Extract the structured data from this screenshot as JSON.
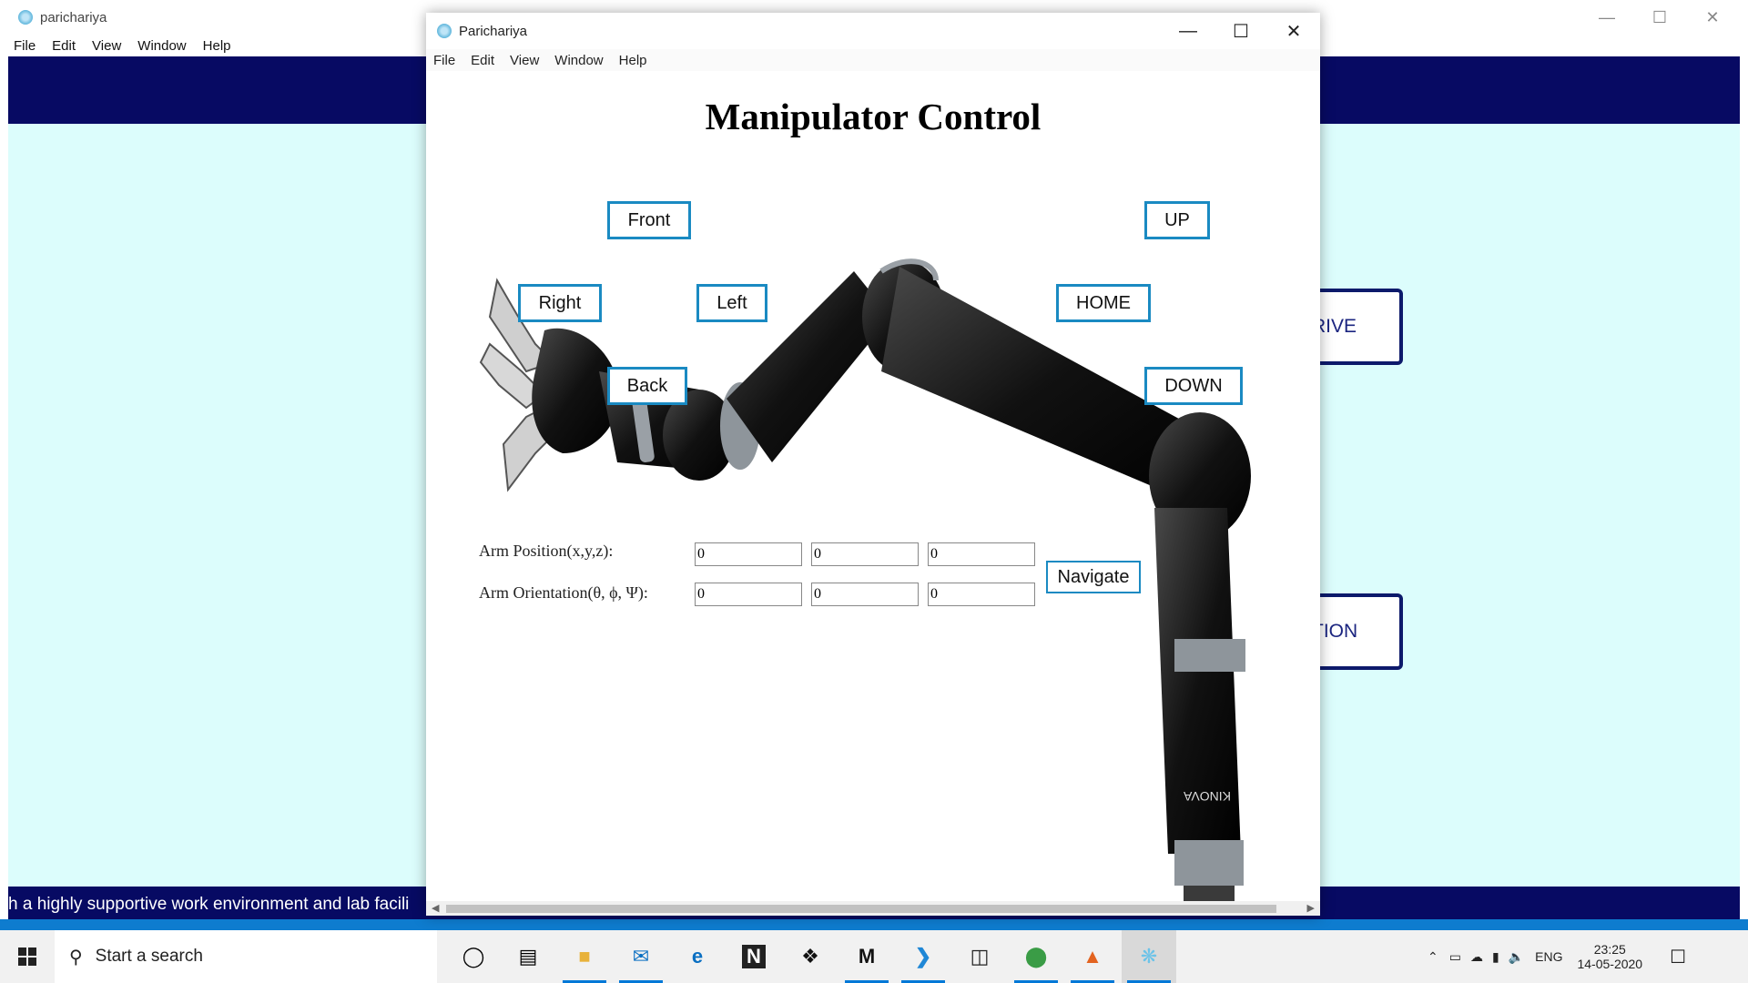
{
  "bg_window": {
    "title": "parichariya",
    "menu": [
      "File",
      "Edit",
      "View",
      "Window",
      "Help"
    ],
    "btn_drive_partial": "RIVE",
    "btn_position_partial": "TION",
    "footer_text": "h a highly supportive work environment and lab facili"
  },
  "fg_window": {
    "title": "Parichariya",
    "menu": [
      "File",
      "Edit",
      "View",
      "Window",
      "Help"
    ],
    "heading": "Manipulator Control",
    "buttons": {
      "front": "Front",
      "up": "UP",
      "right": "Right",
      "left": "Left",
      "home": "HOME",
      "back": "Back",
      "down": "DOWN",
      "navigate": "Navigate"
    },
    "position_label": "Arm Position(x,y,z):",
    "orientation_label": "Arm Orientation(θ, ϕ, Ψ):",
    "position_values": [
      "0",
      "0",
      "0"
    ],
    "orientation_values": [
      "0",
      "0",
      "0"
    ],
    "robot_brand": "KINOVA"
  },
  "taskbar": {
    "search_placeholder": "Start a search",
    "language": "ENG",
    "time": "23:25",
    "date": "14-05-2020",
    "icons": [
      "cortana-icon",
      "task-view-icon",
      "file-explorer-icon",
      "mail-icon",
      "edge-icon",
      "notion-icon",
      "dropbox-icon",
      "medium-icon",
      "vscode-icon",
      "sticky-notes-icon",
      "chrome-icon",
      "matlab-icon",
      "electron-icon"
    ]
  },
  "colors": {
    "bg_header": "#070a63",
    "bg_content": "#dcfdfc",
    "button_border": "#1a8ac2",
    "taskbar_accent": "#0078d7"
  }
}
